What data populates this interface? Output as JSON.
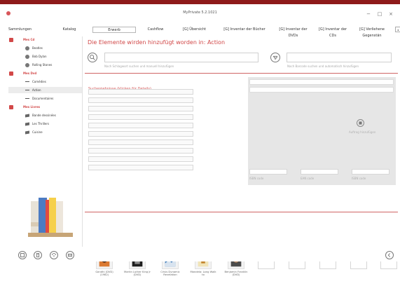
{
  "window": {
    "title": "MyPrivate 5.2.1021",
    "icons": [
      "app-icon",
      "minimize-icon",
      "maximize-icon",
      "close-icon"
    ]
  },
  "tabs": [
    {
      "label": "Sammlungen"
    },
    {
      "label": "Katalog"
    },
    {
      "label": "Erwerb"
    },
    {
      "label": "Cashflow"
    },
    {
      "label": "[G] Übersicht"
    },
    {
      "label": "[G] Inventar der Bücher"
    },
    {
      "label": "[G] Inventar der DVDs"
    },
    {
      "label": "[G] Inventar der CDs"
    },
    {
      "label": "[G] Verliehene Gegenstän"
    }
  ],
  "tab_nav": {
    "prev": "◂",
    "next": "▸"
  },
  "sidebar": {
    "items": [
      {
        "label": "Mes Cd",
        "type": "group"
      },
      {
        "label": "Beatles",
        "type": "cd"
      },
      {
        "label": "Bob Dylan",
        "type": "cd"
      },
      {
        "label": "Rolling Stones",
        "type": "cd"
      },
      {
        "label": "Mes Dvd",
        "type": "group"
      },
      {
        "label": "Comédies",
        "type": "dvd"
      },
      {
        "label": "Action",
        "type": "dvd",
        "selected": true
      },
      {
        "label": "Documentaires",
        "type": "dvd"
      },
      {
        "label": "Mes Livres",
        "type": "group"
      },
      {
        "label": "Bande dessinées",
        "type": "book"
      },
      {
        "label": "Les Thrillers",
        "type": "book"
      },
      {
        "label": "Cuisine",
        "type": "book"
      }
    ]
  },
  "main": {
    "header": "Die Elemente wirden hinzufügt worden in: Action",
    "search_hint": "Nach Schlagwort suchen und manuell hinzufügen",
    "barcode_hint": "Nach Barcode suchen und automatisch hinzufügen",
    "results_label": "Suchergebnisse (klicken für Details)",
    "add_label": "Auftrag hinzufügen",
    "small_labels": [
      "ISBN code",
      "EAN code",
      "ISBN code"
    ]
  },
  "thumbs": [
    {
      "title": "Gandhi (DVD) (1982)"
    },
    {
      "title": "Martin Luther King Jr (DVD)"
    },
    {
      "title": "Crisis Dynamic Revelation"
    },
    {
      "title": "Mandela: Long Walk to"
    },
    {
      "title": "Benjamin Franklin (DVD)"
    },
    {
      "title": ""
    },
    {
      "title": ""
    },
    {
      "title": ""
    },
    {
      "title": ""
    },
    {
      "title": ""
    }
  ],
  "bottom_icons": [
    "add-icon",
    "book-icon",
    "scan-icon",
    "export-icon",
    "back-icon"
  ],
  "colors": {
    "accent": "#d14747",
    "topstrip": "#8e1a1a"
  }
}
